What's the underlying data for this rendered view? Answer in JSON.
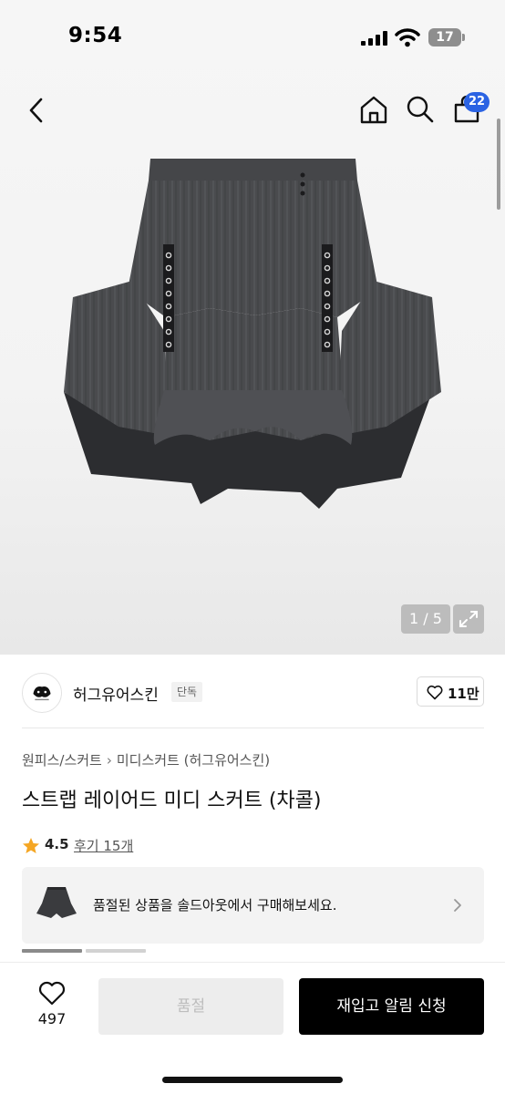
{
  "status_bar": {
    "time": "9:54",
    "battery_level": "17",
    "icons": [
      "signal-icon",
      "wifi-icon",
      "battery-icon"
    ]
  },
  "nav": {
    "icons": [
      "back-chevron-icon",
      "home-icon",
      "search-icon",
      "shopping-bag-icon"
    ],
    "bag_badge": "22"
  },
  "gallery": {
    "counter": "1 / 5",
    "icons": [
      "expand-icon"
    ]
  },
  "brand": {
    "name": "허그유어스킨",
    "tag": "단독",
    "like_count": "11만",
    "icons": [
      "brand-logo",
      "heart-outline-icon"
    ]
  },
  "breadcrumb": {
    "items": [
      "원피스/스커트",
      "미디스커트 (허그유어스킨)"
    ],
    "separator_icon": "chevron-right-icon"
  },
  "product": {
    "title": "스트랩 레이어드 미디 스커트 (차콜)",
    "rating": "4.5",
    "reviews": "후기 15개",
    "icons": [
      "star-icon"
    ]
  },
  "soldout_banner": {
    "text": "품절된 상품을 솔드아웃에서 구매해보세요.",
    "icons": [
      "skirt-thumbnail",
      "chevron-right-icon"
    ]
  },
  "bottom_bar": {
    "wish_count": "497",
    "soldout_label": "품절",
    "restock_label": "재입고 알림 신청",
    "icons": [
      "heart-outline-icon"
    ]
  },
  "colors": {
    "accent_badge": "#2b63e3",
    "primary_button": "#000000",
    "disabled_button": "#ededed",
    "star": "#f5a623"
  }
}
